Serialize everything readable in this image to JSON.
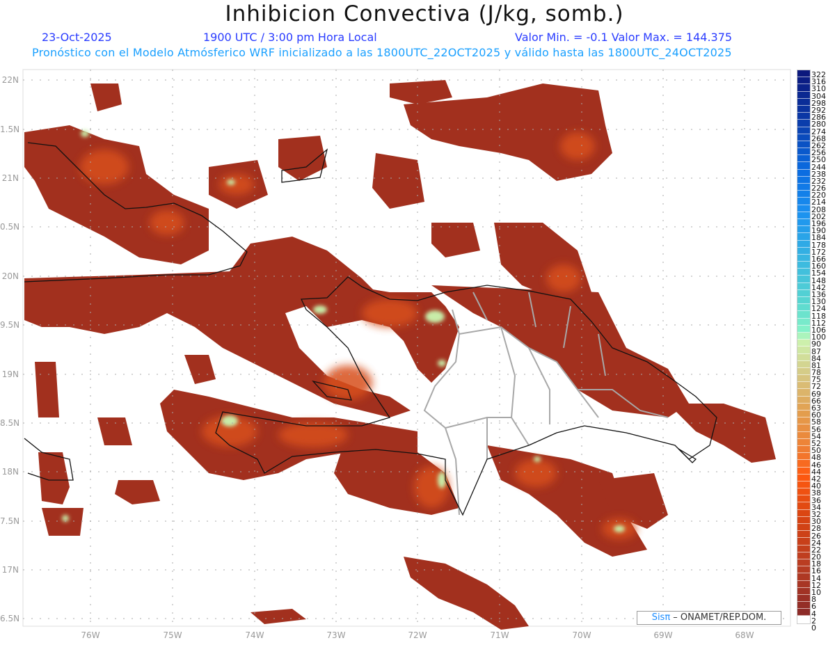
{
  "header": {
    "title": "Inhibicion Convectiva (J/kg, somb.)",
    "date": "23-Oct-2025",
    "time": "1900 UTC / 3:00 pm Hora Local",
    "minmax": "Valor Min. = -0.1  Valor Max. = 144.375",
    "forecast_note": "Pronóstico con el Modelo Atmósferico WRF inicializado a las 1800UTC_22OCT2025 y válido hasta las  1800UTC_24OCT2025"
  },
  "axes": {
    "lat_labels": [
      "22N",
      "1.5N",
      "21N",
      "0.5N",
      "20N",
      "9.5N",
      "19N",
      "8.5N",
      "18N",
      "7.5N",
      "17N",
      "6.5N"
    ],
    "lon_labels": [
      "76W",
      "75W",
      "74W",
      "73W",
      "72W",
      "71W",
      "70W",
      "69W",
      "68W"
    ]
  },
  "colorbar": {
    "labels": [
      "322",
      "316",
      "310",
      "304",
      "298",
      "292",
      "286",
      "280",
      "274",
      "268",
      "262",
      "256",
      "250",
      "244",
      "238",
      "232",
      "226",
      "220",
      "214",
      "208",
      "202",
      "196",
      "190",
      "184",
      "178",
      "172",
      "166",
      "160",
      "154",
      "148",
      "142",
      "136",
      "130",
      "124",
      "118",
      "112",
      "106",
      "100",
      "90",
      "87",
      "84",
      "81",
      "78",
      "75",
      "72",
      "69",
      "66",
      "63",
      "60",
      "58",
      "56",
      "54",
      "52",
      "50",
      "48",
      "46",
      "44",
      "42",
      "40",
      "38",
      "36",
      "34",
      "32",
      "30",
      "28",
      "26",
      "24",
      "22",
      "20",
      "18",
      "16",
      "14",
      "12",
      "10",
      "8",
      "6",
      "4",
      "2",
      "0"
    ],
    "color_stops": [
      {
        "v": 322,
        "c": "#0b157a"
      },
      {
        "v": 280,
        "c": "#0a3aa8"
      },
      {
        "v": 238,
        "c": "#0a6ae0"
      },
      {
        "v": 202,
        "c": "#1a90f0"
      },
      {
        "v": 160,
        "c": "#3ab8e0"
      },
      {
        "v": 124,
        "c": "#5ad8d0"
      },
      {
        "v": 100,
        "c": "#8af4c8"
      },
      {
        "v": 90,
        "c": "#ccf4b0"
      },
      {
        "v": 75,
        "c": "#d6c884"
      },
      {
        "v": 60,
        "c": "#e2a050"
      },
      {
        "v": 48,
        "c": "#f07a30"
      },
      {
        "v": 42,
        "c": "#ff5a10"
      },
      {
        "v": 30,
        "c": "#d84412"
      },
      {
        "v": 16,
        "c": "#b83c22"
      },
      {
        "v": 2,
        "c": "#8a2a28"
      }
    ]
  },
  "credit": {
    "brand": "Sisπ",
    "text": " – ONAMET/REP.DOM."
  },
  "colors": {
    "field": "#a2301e",
    "field_mid": "#c84018",
    "field_hot": "#e8662a",
    "field_peak": "#c8eca8",
    "coast": "#111111",
    "border": "#a8a8a8"
  }
}
